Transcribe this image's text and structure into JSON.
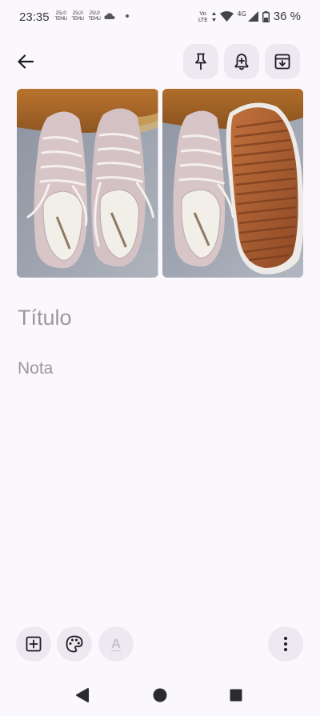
{
  "status_bar": {
    "time": "23:35",
    "notifications": [
      {
        "top": "25/,0",
        "bottom": "TEMU"
      },
      {
        "top": "25/,0",
        "bottom": "TEMU"
      },
      {
        "top": "25/,0",
        "bottom": "TEMU"
      }
    ],
    "volte_top": "Vo",
    "volte_bottom": "LTE",
    "network": "4G",
    "battery": "36 %"
  },
  "toolbar": {
    "back_icon": "arrow-left-icon",
    "pin_icon": "pin-icon",
    "reminder_icon": "bell-plus-icon",
    "archive_icon": "archive-icon"
  },
  "note": {
    "title_placeholder": "Título",
    "body_placeholder": "Nota",
    "images": [
      {
        "alt": "Hush Puppies"
      },
      {
        "alt": "Hush Puppies"
      }
    ]
  },
  "bottom_bar": {
    "add_icon": "add-box-icon",
    "palette_icon": "palette-icon",
    "text_format_label": "A",
    "more_icon": "more-vert-icon"
  },
  "colors": {
    "background": "#FBF8FD",
    "button_bg": "#EDE9F0",
    "placeholder": "#9C979F"
  }
}
